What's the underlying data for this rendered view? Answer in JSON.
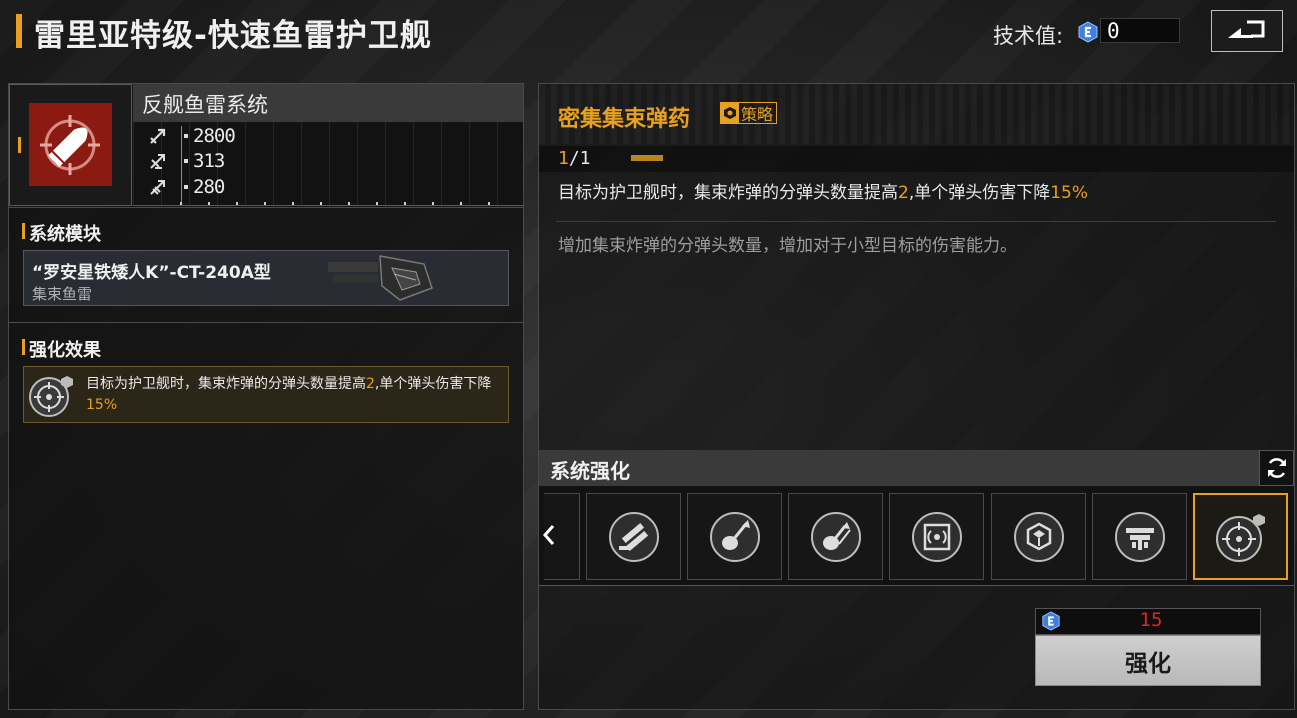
{
  "header": {
    "title": "雷里亚特级-快速鱼雷护卫舰",
    "tech_label": "技术值:",
    "tech_value": "0"
  },
  "weapon": {
    "name": "反舰鱼雷系统",
    "stats": [
      {
        "icon": "attack-icon",
        "value": "2800"
      },
      {
        "icon": "antiair-icon",
        "value": "313"
      },
      {
        "icon": "siege-icon",
        "value": "280"
      }
    ]
  },
  "module": {
    "section_title": "系统模块",
    "name": "“罗安星铁矮人K”-CT-240A型",
    "type": "集束鱼雷"
  },
  "effect": {
    "section_title": "强化效果",
    "text_before": "目标为护卫舰时，集束炸弹的分弹头数量提高",
    "num1": "2",
    "text_middle": ",单个弹头伤害下降",
    "num2": "15%"
  },
  "enhancement": {
    "title": "密集集束弹药",
    "badge": "策略",
    "level_current": "1",
    "level_total": "/1",
    "desc_before": "目标为护卫舰时，集束炸弹的分弹头数量提高",
    "desc_num1": "2",
    "desc_middle": ",单个弹头伤害下降",
    "desc_num2": "15%",
    "flavor": "增加集束炸弹的分弹头数量，增加对于小型目标的伤害能力。"
  },
  "system": {
    "title": "系统强化",
    "slots": [
      {
        "icon": "missile-pair-icon"
      },
      {
        "icon": "guitar-arrow-icon"
      },
      {
        "icon": "guitar-arrow-alt-icon"
      },
      {
        "icon": "chip-signal-icon"
      },
      {
        "icon": "cube-shield-icon"
      },
      {
        "icon": "turret-icon"
      },
      {
        "icon": "crosshair-ammo-icon",
        "selected": true
      }
    ]
  },
  "action": {
    "cost": "15",
    "button_label": "强化"
  },
  "colors": {
    "accent": "#e8a020",
    "cost_red": "#e0261e",
    "tech_blue": "#3f7fe0"
  }
}
